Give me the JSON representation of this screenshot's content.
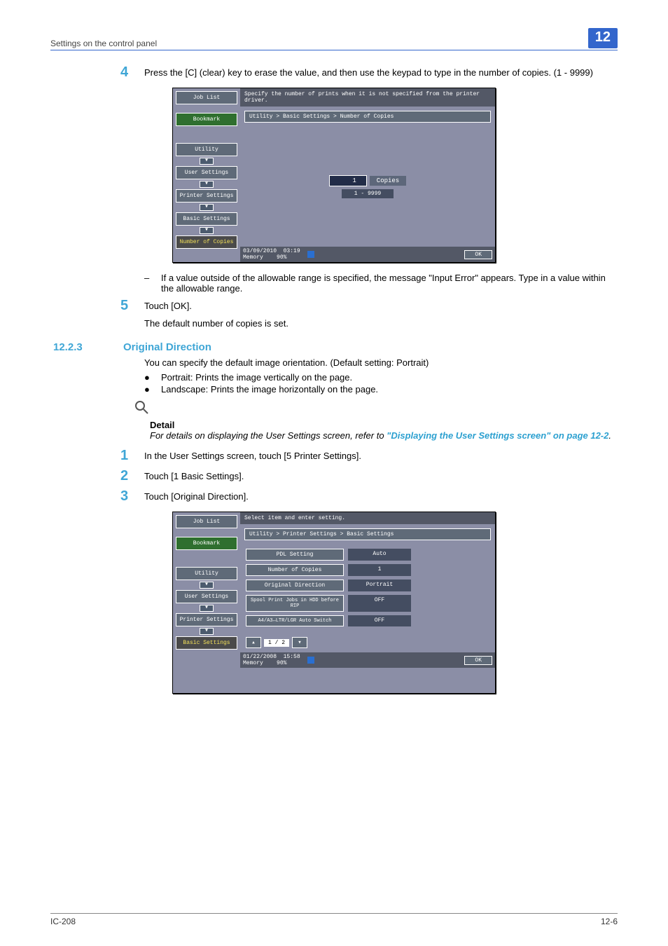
{
  "header": {
    "breadcrumb": "Settings on the control panel",
    "chapter": "12"
  },
  "step4": {
    "num": "4",
    "text": "Press the [C] (clear) key to erase the value, and then use the keypad to type in the number of copies. (1 - 9999)",
    "note": "If a value outside of the allowable range is specified, the message \"Input Error\" appears. Type in a value within the allowable range."
  },
  "screenshot1": {
    "left": {
      "job_list": "Job List",
      "bookmark": "Bookmark",
      "utility": "Utility",
      "user_settings": "User Settings",
      "printer_settings": "Printer Settings",
      "basic_settings": "Basic Settings",
      "number_of_copies": "Number of Copies"
    },
    "header": "Specify the number of prints when it is not specified from the printer driver.",
    "crumb": "Utility > Basic Settings > Number of Copies",
    "copies_value": "1",
    "copies_label": "Copies",
    "copies_range": "1  -  9999",
    "footer_date": "03/09/2010",
    "footer_time": "03:19",
    "footer_mem_label": "Memory",
    "footer_mem_pct": "90%",
    "ok": "OK"
  },
  "step5": {
    "num": "5",
    "text": "Touch [OK].",
    "after": "The default number of copies is set."
  },
  "section": {
    "num": "12.2.3",
    "title": "Original Direction",
    "intro": "You can specify the default image orientation. (Default setting: Portrait)",
    "bul1": "Portrait: Prints the image vertically on the page.",
    "bul2": "Landscape: Prints the image horizontally on the page."
  },
  "detail": {
    "label": "Detail",
    "text_before": "For details on displaying the User Settings screen, refer to ",
    "link": "\"Displaying the User Settings screen\" on page 12-2",
    "text_after": "."
  },
  "steps_b": {
    "s1": {
      "num": "1",
      "text": "In the User Settings screen, touch [5 Printer Settings]."
    },
    "s2": {
      "num": "2",
      "text": "Touch [1 Basic Settings]."
    },
    "s3": {
      "num": "3",
      "text": "Touch [Original Direction]."
    }
  },
  "screenshot2": {
    "left": {
      "job_list": "Job List",
      "bookmark": "Bookmark",
      "utility": "Utility",
      "user_settings": "User Settings",
      "printer_settings": "Printer Settings",
      "basic_settings": "Basic Settings"
    },
    "header": "Select item and enter setting.",
    "crumb": "Utility > Printer Settings > Basic Settings",
    "rows": [
      {
        "label": "PDL Setting",
        "value": "Auto"
      },
      {
        "label": "Number of Copies",
        "value": "1"
      },
      {
        "label": "Original Direction",
        "value": "Portrait"
      },
      {
        "label": "Spool Print Jobs in HDD before RIP",
        "value": "OFF"
      },
      {
        "label": "A4/A3↔LTR/LGR Auto Switch",
        "value": "OFF"
      }
    ],
    "pager": "1 / 2",
    "footer_date": "01/22/2008",
    "footer_time": "15:58",
    "footer_mem_label": "Memory",
    "footer_mem_pct": "90%",
    "ok": "OK"
  },
  "footer": {
    "left": "IC-208",
    "right": "12-6"
  }
}
